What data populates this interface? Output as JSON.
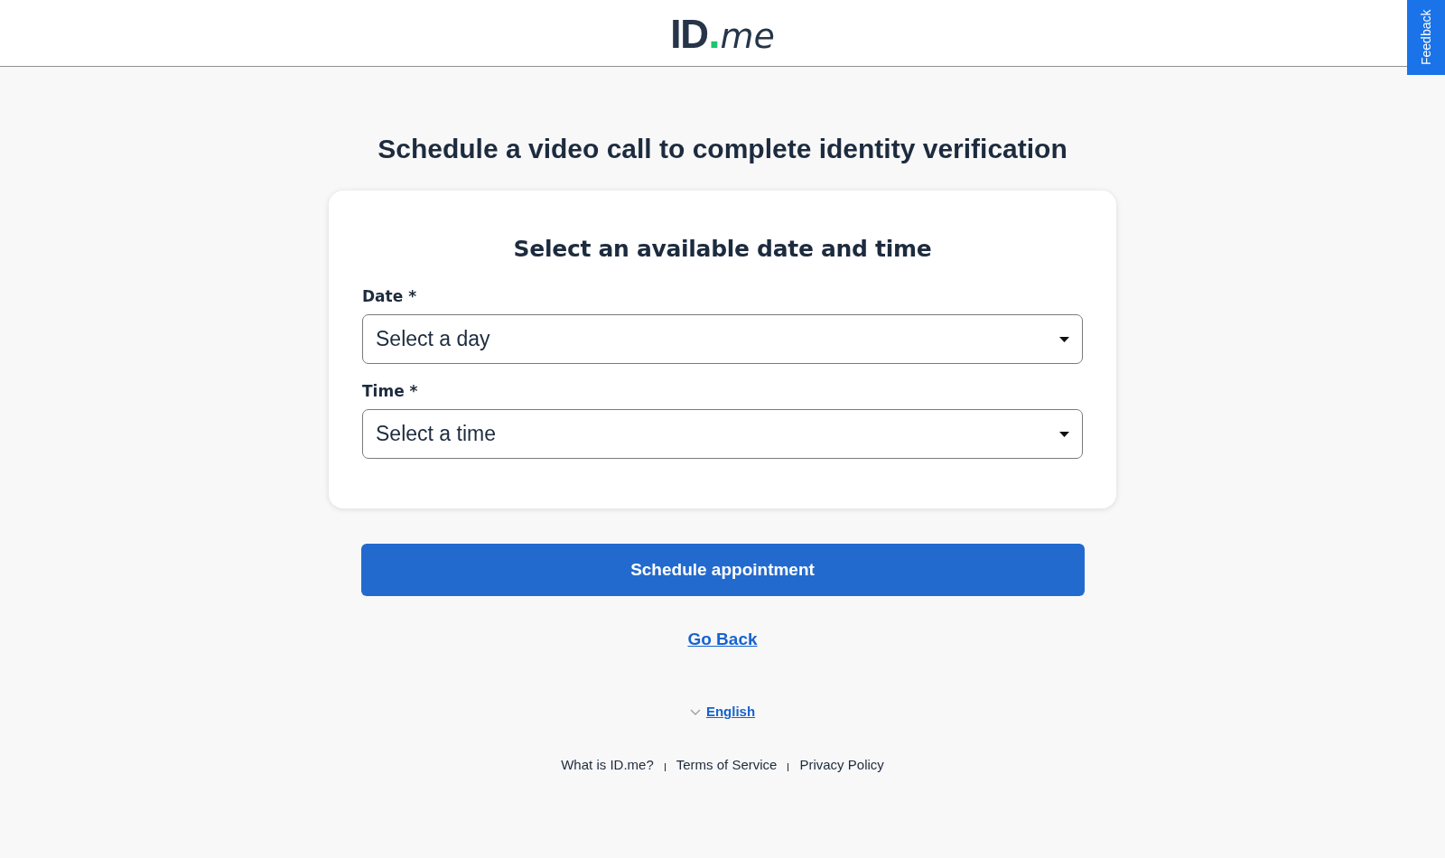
{
  "header": {
    "logo": {
      "main": "ID",
      "separator": ".",
      "suffix": "me"
    },
    "feedback_tab": "Feedback"
  },
  "title": "Schedule a video call to complete identity verification",
  "form": {
    "heading": "Select an available date and time",
    "fields": [
      {
        "label": "Date *",
        "placeholder": "Select a day"
      },
      {
        "label": "Time *",
        "placeholder": "Select a time"
      }
    ]
  },
  "submit_button": "Schedule appointment",
  "back_link": "Go Back",
  "language": "English",
  "footer_links": [
    "What is ID.me?",
    "Terms of Service",
    "Privacy Policy"
  ]
}
